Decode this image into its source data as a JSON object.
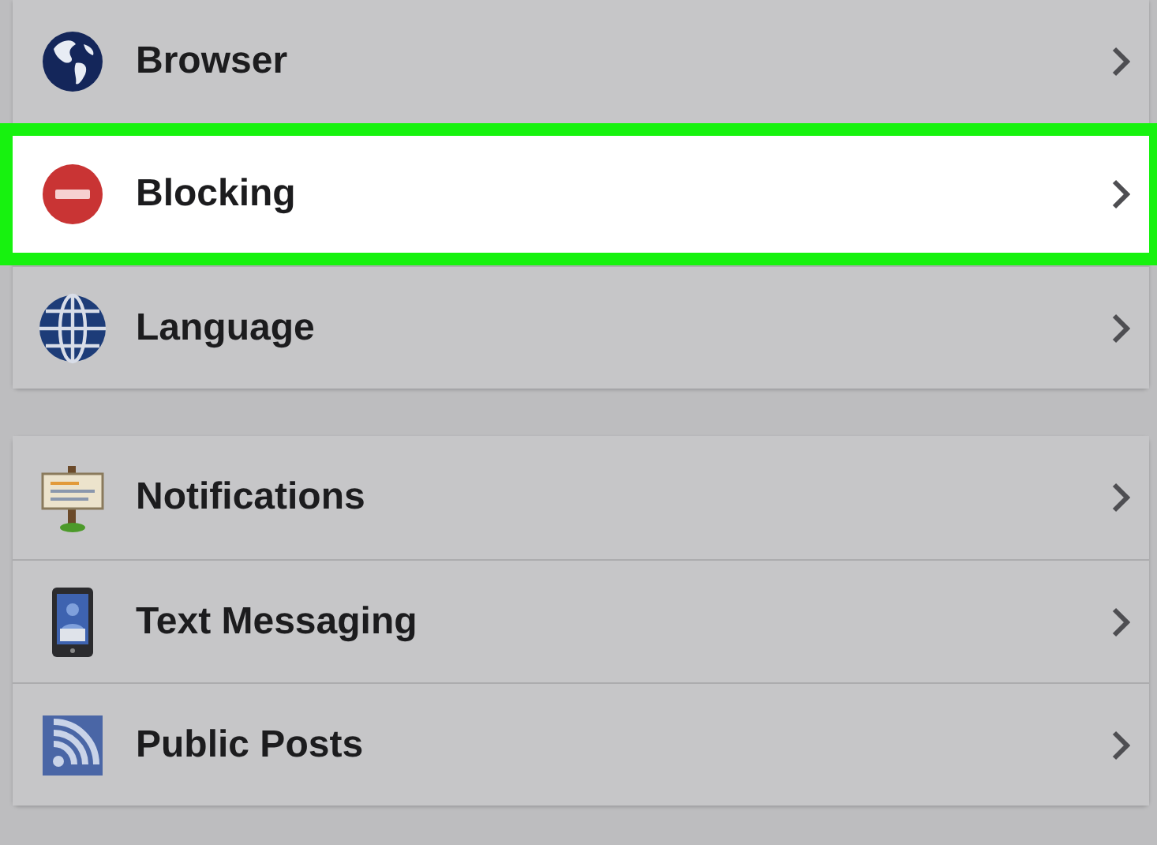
{
  "groups": [
    {
      "items": [
        {
          "label": "Browser",
          "kind": "globe-map",
          "highlighted": false
        },
        {
          "label": "Blocking",
          "kind": "no-entry",
          "highlighted": true
        },
        {
          "label": "Language",
          "kind": "globe-grid",
          "highlighted": false
        }
      ]
    },
    {
      "items": [
        {
          "label": "Notifications",
          "kind": "signboard",
          "highlighted": false
        },
        {
          "label": "Text Messaging",
          "kind": "phone",
          "highlighted": false
        },
        {
          "label": "Public Posts",
          "kind": "rss",
          "highlighted": false
        }
      ]
    }
  ]
}
